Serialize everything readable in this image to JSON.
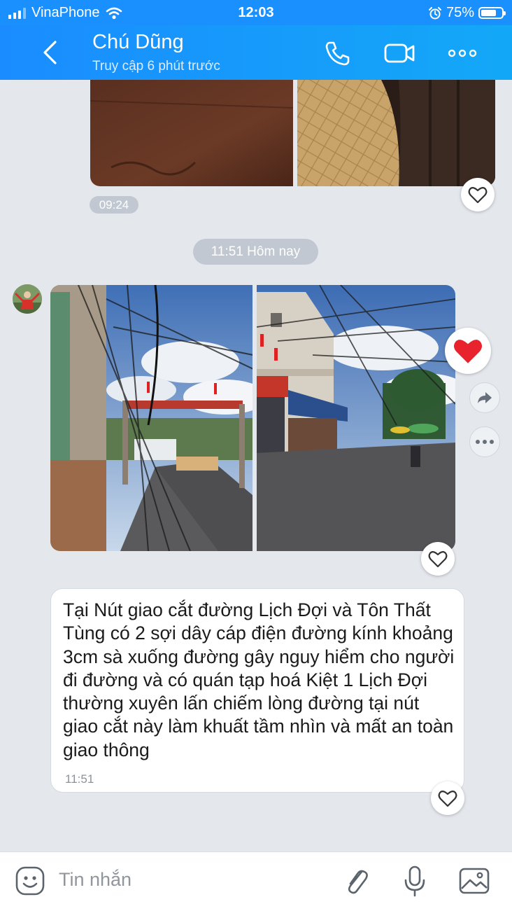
{
  "status_bar": {
    "carrier": "VinaPhone",
    "time": "12:03",
    "battery": "75%",
    "battery_level": 0.75
  },
  "header": {
    "contact_name": "Chú Dũng",
    "last_seen": "Truy cập 6 phút trước"
  },
  "messages": {
    "earlier_photos_time": "09:24",
    "date_separator": "11:51 Hôm nay",
    "text_message": "Tại Nút giao cắt đường Lịch Đợi và Tôn Thất Tùng có 2 sợi dây cáp điện đường kính khoảng 3cm sà xuống đường gây nguy hiểm cho người đi đường và có quán tạp hoá Kiệt 1 Lịch Đợi thường xuyên lấn chiếm lòng đường tại nút giao cắt này làm khuất tầm nhìn và mất an toàn giao thông",
    "text_time": "11:51"
  },
  "composer": {
    "placeholder": "Tin nhắn"
  },
  "colors": {
    "header_start": "#1a8cff",
    "header_end": "#13a8f7",
    "chat_background": "#e4e8ed",
    "heart_red": "#e8232e"
  }
}
